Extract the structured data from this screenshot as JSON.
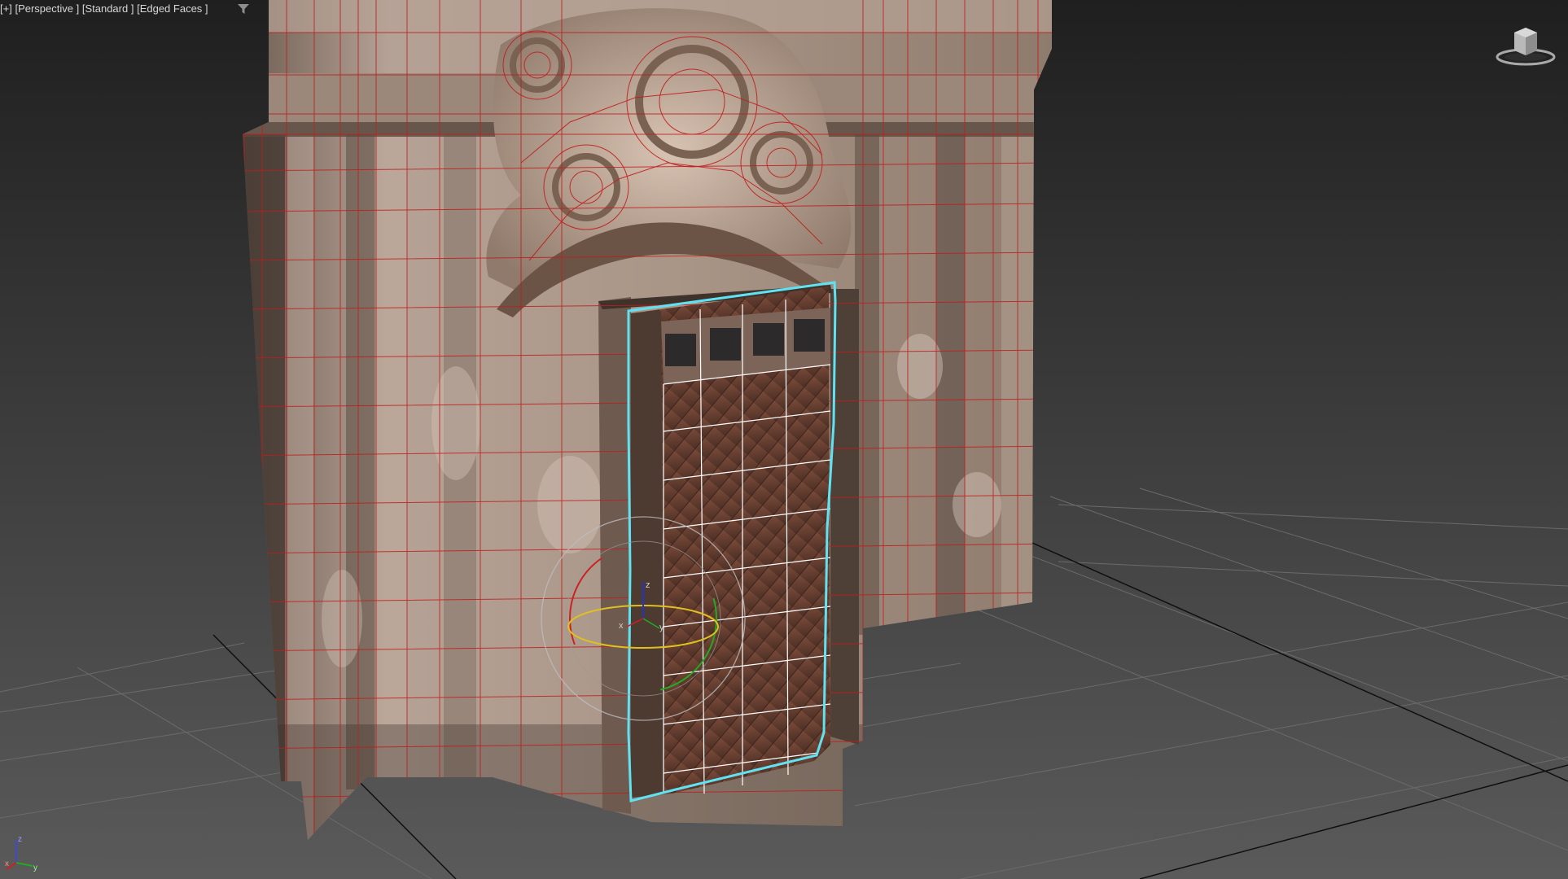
{
  "viewport": {
    "label_items": [
      "[+]",
      "[Perspective ]",
      "[Standard ]",
      "[Edged Faces ]"
    ],
    "projection": "Perspective",
    "shading": "Standard",
    "display_mode": "Edged Faces"
  },
  "viewcube": {
    "icon": "viewcube-icon"
  },
  "gizmo": {
    "axis_x_label": "x",
    "axis_y_label": "y",
    "axis_z_label": "z"
  },
  "tripod": {
    "x": "x",
    "y": "y",
    "z": "z"
  },
  "colors": {
    "background_top": "#1f1f1f",
    "background_bottom": "#5a5a5a",
    "grid_line": "#6b6b6b",
    "grid_main_axis": "#0f0f0f",
    "wireframe_edges": "#c01d1d",
    "selection_outline": "#5fe3f3",
    "selected_edges": "#ffffff",
    "wall_plaster": "#a38f80",
    "door_wood": "#6b4234",
    "gizmo_x": "#cc2222",
    "gizmo_y": "#22aa22",
    "gizmo_z": "#2233cc",
    "gizmo_trackball": "#e0c020"
  }
}
